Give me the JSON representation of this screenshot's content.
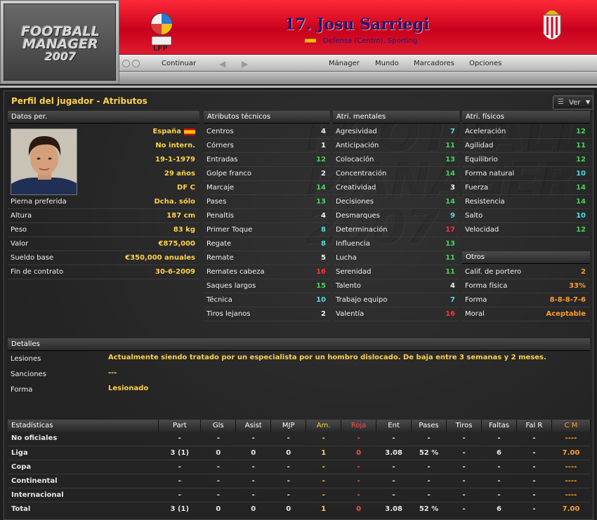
{
  "header": {
    "logo": [
      "FOOTBALL",
      "MANAGER",
      "2007"
    ],
    "lfp_label": "LFP",
    "player_name": "17. Josu Sarriegi",
    "player_sub": "Defensa (Centro), Sporting"
  },
  "nav": {
    "continue": "Continuar",
    "items": [
      "Mánager",
      "Mundo",
      "Marcadores",
      "Opciones"
    ]
  },
  "panel": {
    "title": "Perfil del jugador - Atributos",
    "ver_label": "Ver"
  },
  "personal": {
    "header": "Datos per.",
    "nationality": "España",
    "intl": "No intern.",
    "dob": "19-1-1979",
    "age": "29 años",
    "position": "DF C",
    "rows": [
      {
        "label": "Pierna preferida",
        "value": "Dcha. sólo"
      },
      {
        "label": "Altura",
        "value": "187 cm"
      },
      {
        "label": "Peso",
        "value": "83 kg"
      },
      {
        "label": "Valor",
        "value": "€875,000"
      },
      {
        "label": "Sueldo base",
        "value": "€350,000 anuales"
      },
      {
        "label": "Fin de contrato",
        "value": "30-6-2009"
      }
    ]
  },
  "technical": {
    "header": "Atributos técnicos",
    "rows": [
      {
        "label": "Centros",
        "value": "4"
      },
      {
        "label": "Córners",
        "value": "1"
      },
      {
        "label": "Entradas",
        "value": "12"
      },
      {
        "label": "Golpe franco",
        "value": "2"
      },
      {
        "label": "Marcaje",
        "value": "14"
      },
      {
        "label": "Pases",
        "value": "13"
      },
      {
        "label": "Penaltis",
        "value": "4"
      },
      {
        "label": "Primer Toque",
        "value": "8"
      },
      {
        "label": "Regate",
        "value": "8"
      },
      {
        "label": "Remate",
        "value": "5"
      },
      {
        "label": "Remates cabeza",
        "value": "16"
      },
      {
        "label": "Saques largos",
        "value": "15"
      },
      {
        "label": "Técnica",
        "value": "10"
      },
      {
        "label": "Tiros lejanos",
        "value": "2"
      }
    ]
  },
  "mental": {
    "header": "Atri. mentales",
    "rows": [
      {
        "label": "Agresividad",
        "value": "7"
      },
      {
        "label": "Anticipación",
        "value": "11"
      },
      {
        "label": "Colocación",
        "value": "13"
      },
      {
        "label": "Concentración",
        "value": "14"
      },
      {
        "label": "Creatividad",
        "value": "3"
      },
      {
        "label": "Decisiones",
        "value": "14"
      },
      {
        "label": "Desmarques",
        "value": "9"
      },
      {
        "label": "Determinación",
        "value": "17"
      },
      {
        "label": "Influencia",
        "value": "13"
      },
      {
        "label": "Lucha",
        "value": "11"
      },
      {
        "label": "Serenidad",
        "value": "11"
      },
      {
        "label": "Talento",
        "value": "4"
      },
      {
        "label": "Trabajo equipo",
        "value": "7"
      },
      {
        "label": "Valentía",
        "value": "16"
      }
    ]
  },
  "physical": {
    "header": "Atri. físicos",
    "rows": [
      {
        "label": "Aceleración",
        "value": "12"
      },
      {
        "label": "Agilidad",
        "value": "11"
      },
      {
        "label": "Equilibrio",
        "value": "12"
      },
      {
        "label": "Forma natural",
        "value": "10"
      },
      {
        "label": "Fuerza",
        "value": "14"
      },
      {
        "label": "Resistencia",
        "value": "14"
      },
      {
        "label": "Salto",
        "value": "10"
      },
      {
        "label": "Velocidad",
        "value": "12"
      }
    ]
  },
  "others": {
    "header": "Otros",
    "rows": [
      {
        "label": "Calif. de portero",
        "value": "2"
      },
      {
        "label": "Forma física",
        "value": "33%"
      },
      {
        "label": "Forma",
        "value": "8-8-8-7-6"
      },
      {
        "label": "Moral",
        "value": "Aceptable"
      }
    ]
  },
  "details": {
    "header": "Detalles",
    "rows": [
      {
        "label": "Lesiones",
        "value": "Actualmente siendo tratado por un especialista por un hombro dislocado. De baja entre 3 semanas y 2 meses."
      },
      {
        "label": "Sanciones",
        "value": "---"
      },
      {
        "label": "Forma",
        "value": "Lesionado"
      }
    ]
  },
  "stats": {
    "columns": [
      "Estadísticas",
      "Part",
      "Gls",
      "Asist",
      "MJP",
      "Am.",
      "Roja",
      "Ent",
      "Pases",
      "Tiros",
      "Faltas",
      "Fal R",
      "C M"
    ],
    "rows": [
      [
        "No oficiales",
        "-",
        "-",
        "-",
        "-",
        "-",
        "-",
        "-",
        "-",
        "-",
        "-",
        "-",
        "----"
      ],
      [
        "Liga",
        "3 (1)",
        "0",
        "0",
        "0",
        "1",
        "0",
        "3.08",
        "52 %",
        "-",
        "6",
        "-",
        "7.00"
      ],
      [
        "Copa",
        "-",
        "-",
        "-",
        "-",
        "-",
        "-",
        "-",
        "-",
        "-",
        "-",
        "-",
        "----"
      ],
      [
        "Continental",
        "-",
        "-",
        "-",
        "-",
        "-",
        "-",
        "-",
        "-",
        "-",
        "-",
        "-",
        "----"
      ],
      [
        "Internacional",
        "-",
        "-",
        "-",
        "-",
        "-",
        "-",
        "-",
        "-",
        "-",
        "-",
        "-",
        "----"
      ],
      [
        "Total",
        "3 (1)",
        "0",
        "0",
        "0",
        "1",
        "0",
        "3.08",
        "52 %",
        "-",
        "6",
        "-",
        "7.00"
      ]
    ]
  },
  "colors": {
    "title_yellow": "#ffd24a",
    "high": "#49d35a",
    "mid": "#5ad7e6",
    "top": "#ff3333",
    "header_red": "#e01c30"
  }
}
